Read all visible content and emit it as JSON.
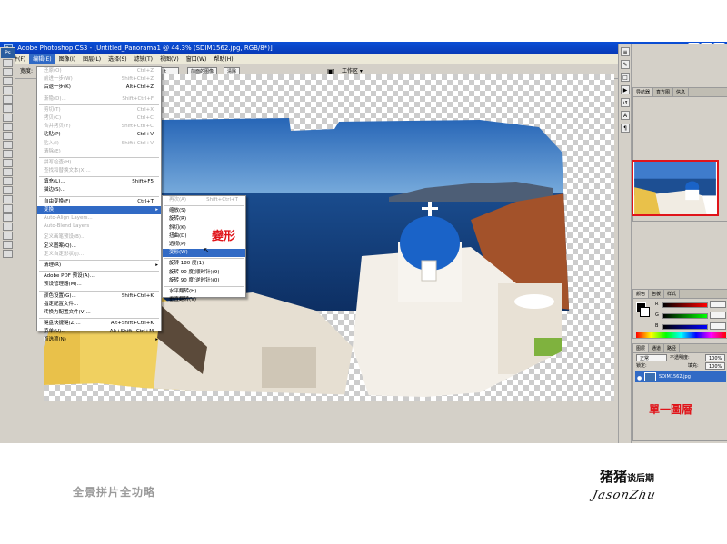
{
  "window": {
    "title": "Adobe Photoshop CS3 - [Untitled_Panorama1 @ 44.3% (SDIM1562.jpg, RGB/8*)]",
    "app_icon": "Ps"
  },
  "menubar": [
    "文件(F)",
    "编辑(E)",
    "图像(I)",
    "图层(L)",
    "选择(S)",
    "滤镜(T)",
    "视图(V)",
    "窗口(W)",
    "帮助(H)"
  ],
  "options_bar": {
    "prefix": "宽度:",
    "before_btn": "前面的图像",
    "clear_btn": "清除",
    "workspace": "工作区 ▾",
    "mode_value": "t"
  },
  "edit_menu": {
    "items": [
      {
        "label": "还原(O)",
        "shortcut": "Ctrl+Z",
        "disabled": true
      },
      {
        "label": "前进一步(W)",
        "shortcut": "Shift+Ctrl+Z",
        "disabled": true
      },
      {
        "label": "后退一步(K)",
        "shortcut": "Alt+Ctrl+Z",
        "disabled": false
      },
      {
        "sep": true
      },
      {
        "label": "渐隐(D)...",
        "shortcut": "Shift+Ctrl+F",
        "disabled": true
      },
      {
        "sep": true
      },
      {
        "label": "剪切(T)",
        "shortcut": "Ctrl+X",
        "disabled": true
      },
      {
        "label": "拷贝(C)",
        "shortcut": "Ctrl+C",
        "disabled": true
      },
      {
        "label": "合并拷贝(Y)",
        "shortcut": "Shift+Ctrl+C",
        "disabled": true
      },
      {
        "label": "粘贴(P)",
        "shortcut": "Ctrl+V",
        "disabled": false
      },
      {
        "label": "贴入(I)",
        "shortcut": "Shift+Ctrl+V",
        "disabled": true
      },
      {
        "label": "清除(E)",
        "shortcut": "",
        "disabled": true
      },
      {
        "sep": true
      },
      {
        "label": "拼写检查(H)...",
        "shortcut": "",
        "disabled": true
      },
      {
        "label": "查找和替换文本(X)...",
        "shortcut": "",
        "disabled": true
      },
      {
        "sep": true
      },
      {
        "label": "填充(L)...",
        "shortcut": "Shift+F5",
        "disabled": false
      },
      {
        "label": "描边(S)...",
        "shortcut": "",
        "disabled": false
      },
      {
        "sep": true
      },
      {
        "label": "自由变换(F)",
        "shortcut": "Ctrl+T",
        "disabled": false
      },
      {
        "label": "变换",
        "shortcut": "",
        "disabled": false,
        "highlight": true,
        "submenu": true
      },
      {
        "label": "Auto-Align Layers...",
        "shortcut": "",
        "disabled": true
      },
      {
        "label": "Auto-Blend Layers",
        "shortcut": "",
        "disabled": true
      },
      {
        "sep": true
      },
      {
        "label": "定义画笔预设(B)...",
        "shortcut": "",
        "disabled": true
      },
      {
        "label": "定义图案(Q)...",
        "shortcut": "",
        "disabled": false
      },
      {
        "label": "定义自定形状(J)...",
        "shortcut": "",
        "disabled": true
      },
      {
        "sep": true
      },
      {
        "label": "清理(R)",
        "shortcut": "",
        "disabled": false,
        "submenu": true
      },
      {
        "sep": true
      },
      {
        "label": "Adobe PDF 预设(A)...",
        "shortcut": "",
        "disabled": false
      },
      {
        "label": "预设管理器(M)...",
        "shortcut": "",
        "disabled": false
      },
      {
        "sep": true
      },
      {
        "label": "颜色设置(G)...",
        "shortcut": "Shift+Ctrl+K",
        "disabled": false
      },
      {
        "label": "指定配置文件...",
        "shortcut": "",
        "disabled": false
      },
      {
        "label": "转换为配置文件(V)...",
        "shortcut": "",
        "disabled": false
      },
      {
        "sep": true
      },
      {
        "label": "键盘快捷键(Z)...",
        "shortcut": "Alt+Shift+Ctrl+K",
        "disabled": false
      },
      {
        "label": "菜单(U)...",
        "shortcut": "Alt+Shift+Ctrl+M",
        "disabled": false
      },
      {
        "label": "首选项(N)",
        "shortcut": "",
        "disabled": false,
        "submenu": true
      }
    ]
  },
  "transform_submenu": {
    "items": [
      {
        "label": "再次(A)",
        "shortcut": "Shift+Ctrl+T",
        "disabled": true
      },
      {
        "sep": true
      },
      {
        "label": "缩放(S)",
        "disabled": false
      },
      {
        "label": "旋转(R)",
        "disabled": false
      },
      {
        "label": "斜切(K)",
        "disabled": false
      },
      {
        "label": "扭曲(D)",
        "disabled": false
      },
      {
        "label": "透视(P)",
        "disabled": false
      },
      {
        "label": "变形(W)",
        "disabled": false,
        "highlight": true
      },
      {
        "sep": true
      },
      {
        "label": "旋转 180 度(1)",
        "disabled": false
      },
      {
        "label": "旋转 90 度(顺时针)(9)",
        "disabled": false
      },
      {
        "label": "旋转 90 度(逆时针)(0)",
        "disabled": false
      },
      {
        "sep": true
      },
      {
        "label": "水平翻转(H)",
        "disabled": false
      },
      {
        "label": "垂直翻转(V)",
        "disabled": false
      }
    ]
  },
  "annotations": {
    "transform": "變形",
    "single_layer": "單一圖層"
  },
  "navigator": {
    "tabs": [
      "导航器",
      "直方图",
      "信息"
    ]
  },
  "color_panel": {
    "tabs": [
      "颜色",
      "色板",
      "样式"
    ],
    "channels": [
      "R",
      "G",
      "B"
    ],
    "values": [
      "",
      "",
      ""
    ]
  },
  "layers_panel": {
    "tabs": [
      "图层",
      "通道",
      "路径"
    ],
    "blend_mode": "正常",
    "opacity_label": "不透明度:",
    "opacity": "100%",
    "lock_label": "锁定:",
    "fill_label": "填充:",
    "fill": "100%",
    "layer_name": "SDIM1562.jpg"
  },
  "footer": {
    "caption": "全景拼片全功略",
    "brand": "猪猪",
    "brand_suffix": "谈后期",
    "signature": "JasonZhu"
  },
  "colors": {
    "accent": "#316ac5",
    "title_bar": "#0a4fd6",
    "annotation_red": "#e0141a"
  }
}
